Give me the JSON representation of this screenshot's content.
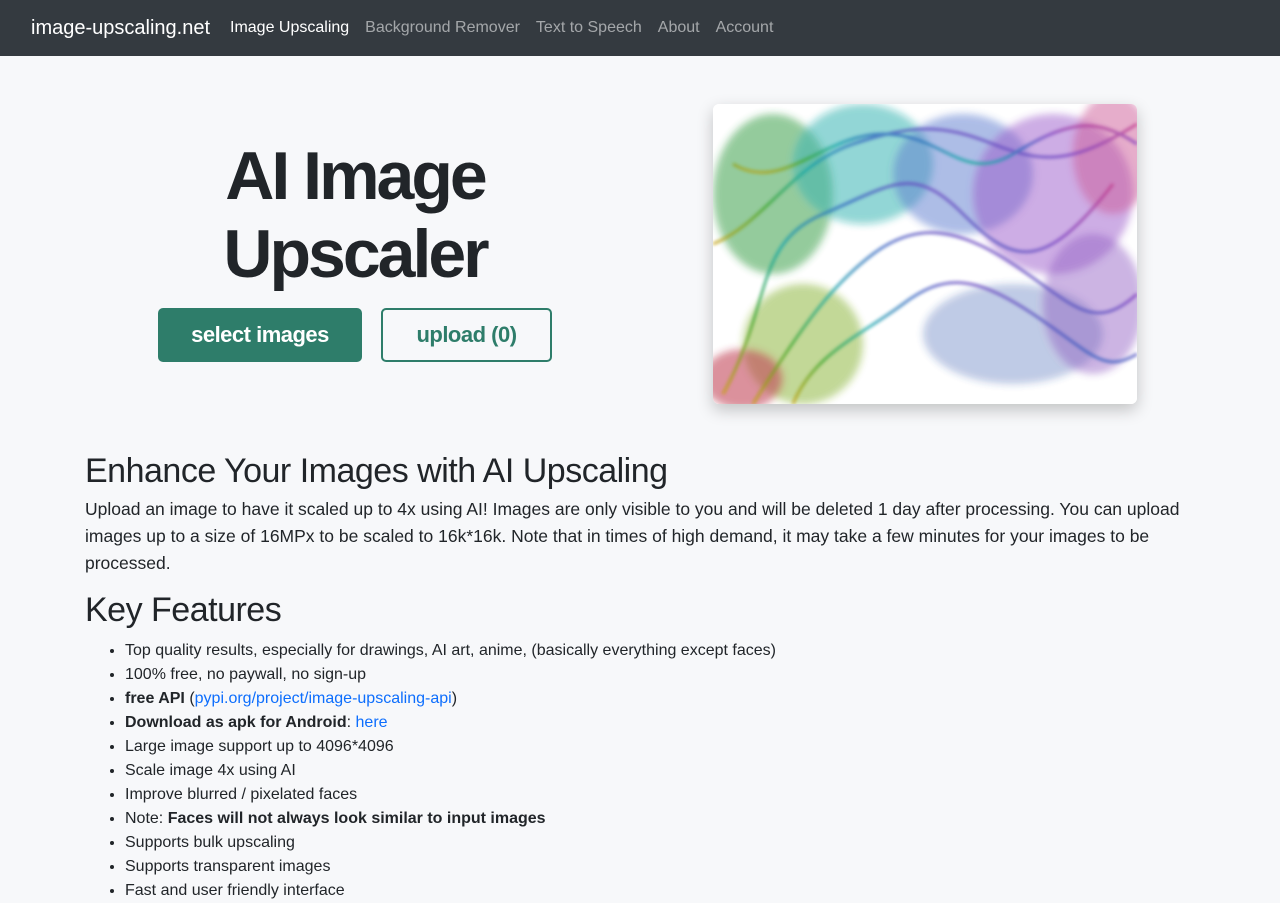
{
  "navbar": {
    "brand": "image-upscaling.net",
    "links": [
      {
        "label": "Image Upscaling",
        "active": true
      },
      {
        "label": "Background Remover",
        "active": false
      },
      {
        "label": "Text to Speech",
        "active": false
      },
      {
        "label": "About",
        "active": false
      },
      {
        "label": "Account",
        "active": false
      }
    ]
  },
  "hero": {
    "title_line1": "AI Image",
    "title_line2": "Upscaler",
    "select_button": "select images",
    "upload_button": "upload (0)",
    "image_icon": "colored-smoke-image"
  },
  "intro": {
    "heading": "Enhance Your Images with AI Upscaling",
    "text": "Upload an image to have it scaled up to 4x using AI! Images are only visible to you and will be deleted 1 day after processing. You can upload images up to a size of 16MPx to be scaled to 16k*16k. Note that in times of high demand, it may take a few minutes for your images to be processed."
  },
  "features": {
    "heading": "Key Features",
    "items": {
      "f1": "Top quality results, especially for drawings, AI art, anime, (basically everything except faces)",
      "f2": "100% free, no paywall, no sign-up",
      "f3_bold": "free API",
      "f3_open": " (",
      "f3_link": "pypi.org/project/image-upscaling-api",
      "f3_close": ")",
      "f4_bold": "Download as apk for Android",
      "f4_sep": ": ",
      "f4_link": "here",
      "f5": "Large image support up to 4096*4096",
      "f6": "Scale image 4x using AI",
      "f7": "Improve blurred / pixelated faces",
      "f8_prefix": "Note: ",
      "f8_bold": "Faces will not always look similar to input images",
      "f9": "Supports bulk upscaling",
      "f10": "Supports transparent images",
      "f11": "Fast and user friendly interface"
    }
  },
  "colors": {
    "navbar_bg": "#343a40",
    "accent": "#2e7d6a",
    "link": "#0d6efd",
    "page_bg": "#f7f8fa"
  }
}
